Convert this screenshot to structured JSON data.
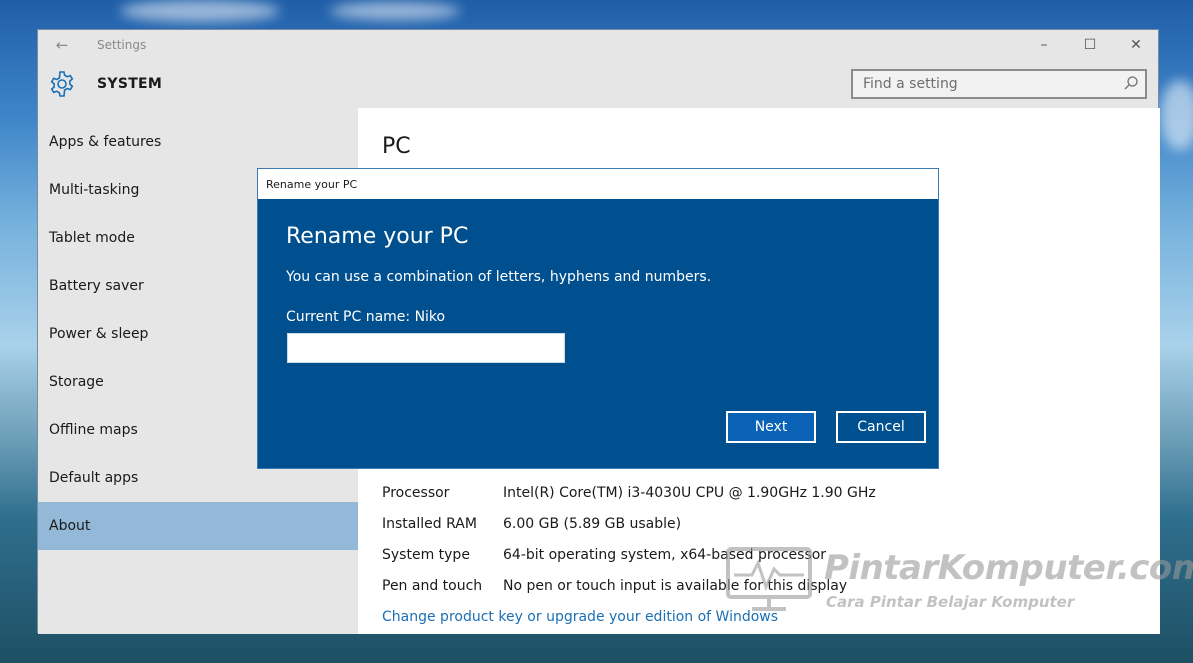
{
  "window": {
    "title": "Settings",
    "section": "SYSTEM"
  },
  "search": {
    "placeholder": "Find a setting"
  },
  "sidebar": {
    "items": [
      {
        "label": "Apps & features"
      },
      {
        "label": "Multi-tasking"
      },
      {
        "label": "Tablet mode"
      },
      {
        "label": "Battery saver"
      },
      {
        "label": "Power & sleep"
      },
      {
        "label": "Storage"
      },
      {
        "label": "Offline maps"
      },
      {
        "label": "Default apps"
      },
      {
        "label": "About",
        "active": true
      }
    ]
  },
  "main": {
    "title": "PC",
    "specs": [
      {
        "label": "Processor",
        "value": "Intel(R) Core(TM) i3-4030U CPU @ 1.90GHz   1.90 GHz"
      },
      {
        "label": "Installed RAM",
        "value": "6.00 GB (5.89 GB usable)"
      },
      {
        "label": "System type",
        "value": "64-bit operating system, x64-based processor"
      },
      {
        "label": "Pen and touch",
        "value": "No pen or touch input is available for this display"
      }
    ],
    "link": "Change product key or upgrade your edition of Windows"
  },
  "dialog": {
    "titlebar": "Rename your PC",
    "heading": "Rename your PC",
    "description": "You can use a combination of letters, hyphens and numbers.",
    "current_name": "Current PC name: Niko",
    "input_value": "",
    "next_label": "Next",
    "cancel_label": "Cancel"
  },
  "watermark": {
    "title": "PintarKomputer.com",
    "subtitle": "Cara Pintar Belajar Komputer"
  },
  "colors": {
    "accent": "#00508f",
    "active_nav": "#94b9d8",
    "link": "#1a6fb5"
  }
}
